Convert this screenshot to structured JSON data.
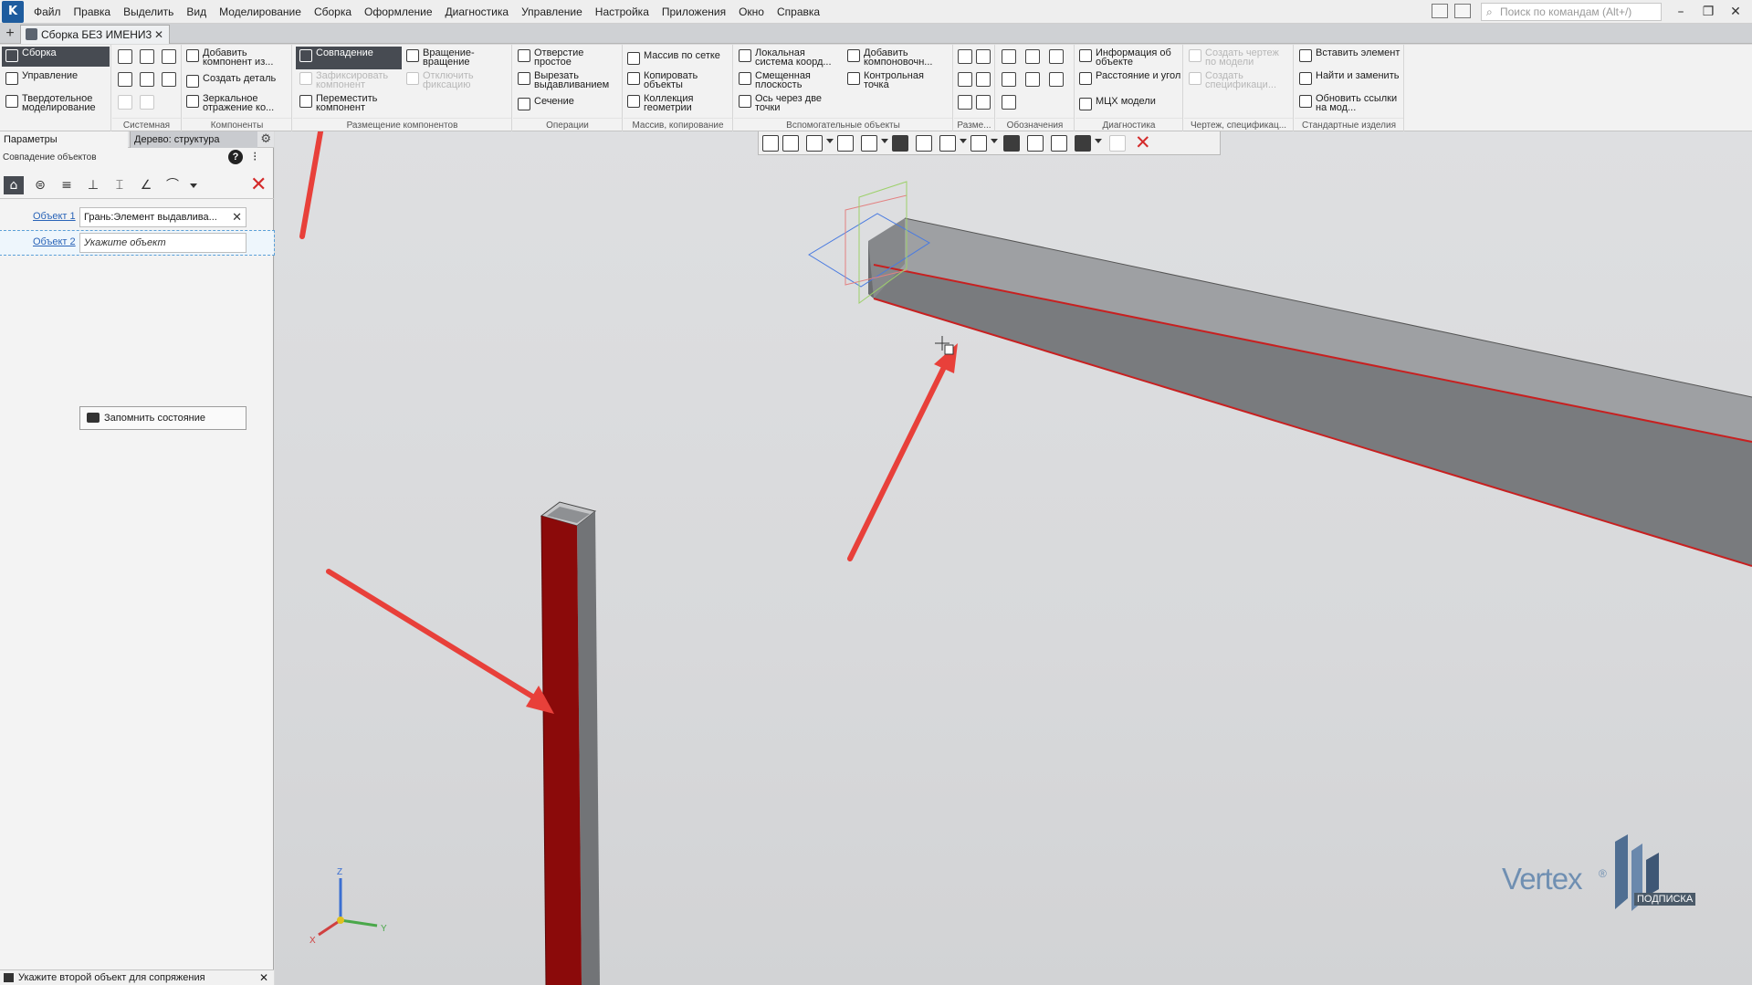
{
  "menu": {
    "items": [
      "Файл",
      "Правка",
      "Выделить",
      "Вид",
      "Моделирование",
      "Сборка",
      "Оформление",
      "Диагностика",
      "Управление",
      "Настройка",
      "Приложения",
      "Окно",
      "Справка"
    ],
    "search_placeholder": "Поиск по командам (Alt+/)"
  },
  "window": {
    "minimize": "–",
    "restore": "❐",
    "close": "✕"
  },
  "tabs": {
    "add": "+",
    "document": "Сборка БЕЗ ИМЕНИ3",
    "close": "✕"
  },
  "ribbon": {
    "modes": [
      "Сборка",
      "Управление",
      "Твердотельное моделирование"
    ],
    "groups": {
      "system": "Системная",
      "components": "Компоненты",
      "placement": "Размещение компонентов",
      "operations": "Операции",
      "array": "Массив, копирование",
      "aux": "Вспомогательные объекты",
      "dims": "Разме...",
      "notation": "Обозначения",
      "diagnostics": "Диагностика",
      "drawing": "Чертеж, спецификац...",
      "standard": "Стандартные изделия"
    },
    "buttons": {
      "add_component": "Добавить компонент из...",
      "create_part": "Создать деталь",
      "mirror": "Зеркальное отражение ко...",
      "coincidence": "Совпадение",
      "fix_component": "Зафиксировать компонент",
      "move_component": "Переместить компонент",
      "rotation": "Вращение-вращение",
      "unfix": "Отключить фиксацию",
      "hole": "Отверстие простое",
      "cut_extrude": "Вырезать выдавливанием",
      "section": "Сечение",
      "grid_array": "Массив по сетке",
      "copy_objects": "Копировать объекты",
      "geometry_collection": "Коллекция геометрии",
      "local_cs": "Локальная система коорд...",
      "offset_plane": "Смещенная плоскость",
      "axis_two_points": "Ось через две точки",
      "add_layout": "Добавить компоновочн...",
      "control_point": "Контрольная точка",
      "object_info": "Информация об объекте",
      "distance_angle": "Расстояние и угол",
      "mass_props": "МЦХ модели",
      "create_drawing": "Создать чертеж по модели",
      "create_spec": "Создать спецификаци...",
      "insert_element": "Вставить элемент",
      "find_replace": "Найти и заменить",
      "update_links": "Обновить ссылки на мод..."
    }
  },
  "panel": {
    "tab_params": "Параметры",
    "tab_tree": "Дерево: структура",
    "gear": "⚙",
    "command_title": "Совпадение объектов",
    "help": "?",
    "tree_icon": "⁝",
    "constraint_icons": [
      "⌂",
      "⊜",
      "≡",
      "⊥",
      "⌶",
      "∠",
      "⌒"
    ],
    "cancel": "✕",
    "object1_label": "Объект 1",
    "object1_value": "Грань:Элемент выдавлива...",
    "object1_clear": "✕",
    "object2_label": "Объект 2",
    "object2_placeholder": "Укажите объект",
    "save_state": "Запомнить состояние"
  },
  "status": {
    "text": "Укажите второй объект для сопряжения",
    "close": "✕"
  },
  "viewport": {
    "triad": {
      "z": "Z",
      "x": "X",
      "y": "Y"
    },
    "highlight_color": "#8b0a0a",
    "arrow_color": "#e8403a",
    "beam_color": "#7d7f82"
  },
  "watermark": {
    "brand": "Vertex",
    "registered": "®",
    "label": "ПОДПИСКА"
  }
}
